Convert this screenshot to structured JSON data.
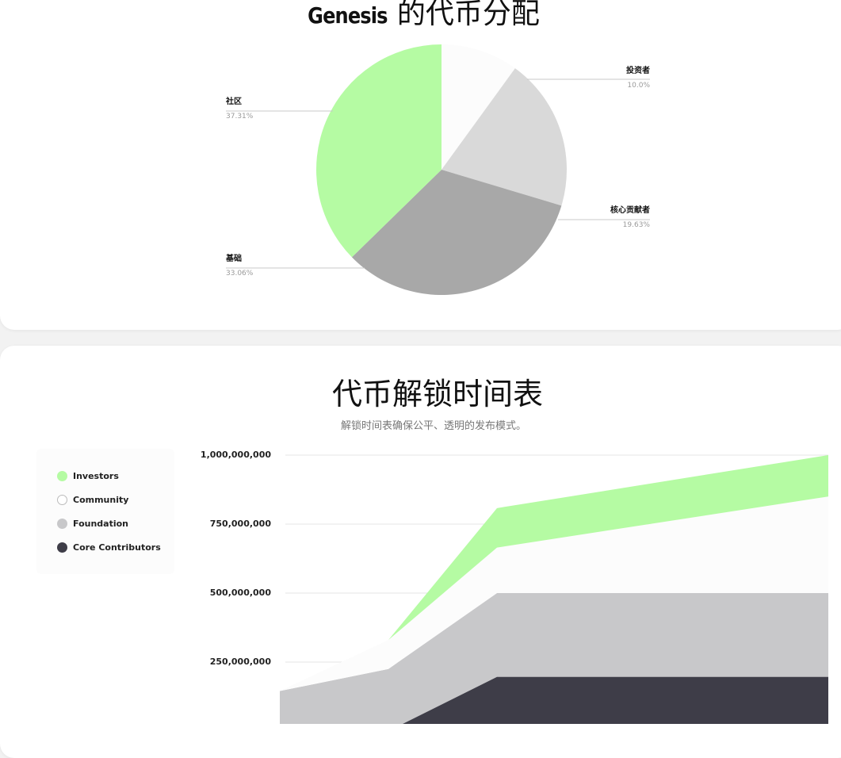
{
  "distribution": {
    "title_brand": "Genesis",
    "title_rest": "的代币分配"
  },
  "schedule": {
    "title": "代币解锁时间表",
    "subtitle": "解锁时间表确保公平、透明的发布模式。"
  },
  "colors": {
    "green": "#b5fba3",
    "white": "#fcfcfc",
    "light_gray": "#d9d9d9",
    "mid_gray": "#a8a8a8",
    "foundation_gray": "#c8c8ca",
    "dark": "#3e3d48"
  },
  "chart_data": [
    {
      "type": "pie",
      "title": "",
      "slices": [
        {
          "label": "投资者",
          "value": 10.0,
          "display": "10.0%",
          "color": "#fcfcfc"
        },
        {
          "label": "核心贡献者",
          "value": 19.63,
          "display": "19.63%",
          "color": "#d9d9d9"
        },
        {
          "label": "基础",
          "value": 33.06,
          "display": "33.06%",
          "color": "#a8a8a8"
        },
        {
          "label": "社区",
          "value": 37.31,
          "display": "37.31%",
          "color": "#b5fba3"
        }
      ]
    },
    {
      "type": "area",
      "title": "",
      "legend": [
        {
          "name": "Investors",
          "color": "#b5fba3"
        },
        {
          "name": "Community",
          "color": "#ffffff"
        },
        {
          "name": "Foundation",
          "color": "#c8c8ca"
        },
        {
          "name": "Core Contributors",
          "color": "#3e3d48"
        }
      ],
      "y_ticks": [
        "1,000,000,000",
        "750,000,000",
        "500,000,000",
        "250,000,000"
      ],
      "ylim": [
        0,
        1000000000
      ],
      "x": [
        0,
        1,
        2,
        3
      ],
      "series": [
        {
          "name": "Core Contributors",
          "values": [
            0,
            0,
            196000000,
            196000000
          ]
        },
        {
          "name": "Foundation",
          "values": [
            0,
            0,
            0,
            0
          ]
        },
        {
          "name": "Community",
          "values": [
            0,
            0,
            0,
            0
          ]
        },
        {
          "name": "Investors",
          "values": [
            0,
            0,
            0,
            0
          ]
        }
      ],
      "layers": {
        "core_top": [
          [
            0,
            -60000000
          ],
          [
            1,
            0
          ],
          [
            2,
            196000000
          ],
          [
            3,
            196000000
          ]
        ],
        "foundation_top": [
          [
            0,
            145000000
          ],
          [
            1,
            225000000
          ],
          [
            2,
            500000000
          ],
          [
            3,
            500000000
          ]
        ],
        "community_top": [
          [
            0,
            145000000
          ],
          [
            1,
            330000000
          ],
          [
            2,
            665000000
          ],
          [
            3,
            850000000
          ]
        ],
        "investors_top": [
          [
            1,
            330000000
          ],
          [
            2,
            808000000
          ],
          [
            3,
            1000000000
          ]
        ]
      }
    }
  ]
}
